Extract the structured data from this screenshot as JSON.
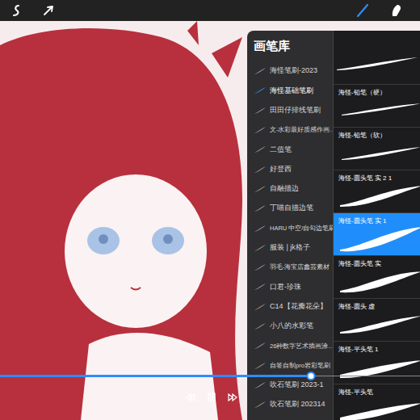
{
  "tools": [
    {
      "kind": "brush",
      "selected": true
    },
    {
      "kind": "smudge",
      "selected": false
    }
  ],
  "brush_library": {
    "title": "画笔库",
    "sets": [
      {
        "label": "海怪笔刷-2023",
        "selected": false
      },
      {
        "label": "海怪基础笔刷",
        "selected": true
      },
      {
        "label": "田田仔排线笔刷",
        "selected": false
      },
      {
        "label": "文-水彩最好质感作画…",
        "selected": false
      },
      {
        "label": "二值笔",
        "selected": false
      },
      {
        "label": "好登西",
        "selected": false
      },
      {
        "label": "自融描边",
        "selected": false
      },
      {
        "label": "丁喵自描边笔",
        "selected": false
      },
      {
        "label": "HARU 中空/自勾边笔刷",
        "selected": false
      },
      {
        "label": "服装 | jk格子",
        "selected": false
      },
      {
        "label": "羽毛-海宝店鑫芸素材",
        "selected": false
      },
      {
        "label": "口君-珍珠",
        "selected": false
      },
      {
        "label": "C14【花瓣花朵】",
        "selected": false
      },
      {
        "label": "小八的水彩笔",
        "selected": false
      },
      {
        "label": "26种数字艺术插画涂…",
        "selected": false
      },
      {
        "label": "自签自制pro岩彩笔刷",
        "selected": false
      },
      {
        "label": "吹石笔刷 2023-1",
        "selected": false
      },
      {
        "label": "吹石笔刷 202314",
        "selected": false
      }
    ],
    "brushes": [
      {
        "label": "海怪-铅笔（硬）",
        "selected": false
      },
      {
        "label": "海怪-铅笔（软）",
        "selected": false
      },
      {
        "label": "海怪-圆头笔 实 2 1",
        "selected": false
      },
      {
        "label": "海怪-圆头笔 实 1",
        "selected": true
      },
      {
        "label": "海怪-圆头笔 实",
        "selected": false
      },
      {
        "label": "海怪-圆头 虚",
        "selected": false
      },
      {
        "label": "海怪-平头笔 1",
        "selected": false
      },
      {
        "label": "海怪-平头笔",
        "selected": false
      }
    ]
  },
  "timeline": {
    "level": 0.74
  }
}
